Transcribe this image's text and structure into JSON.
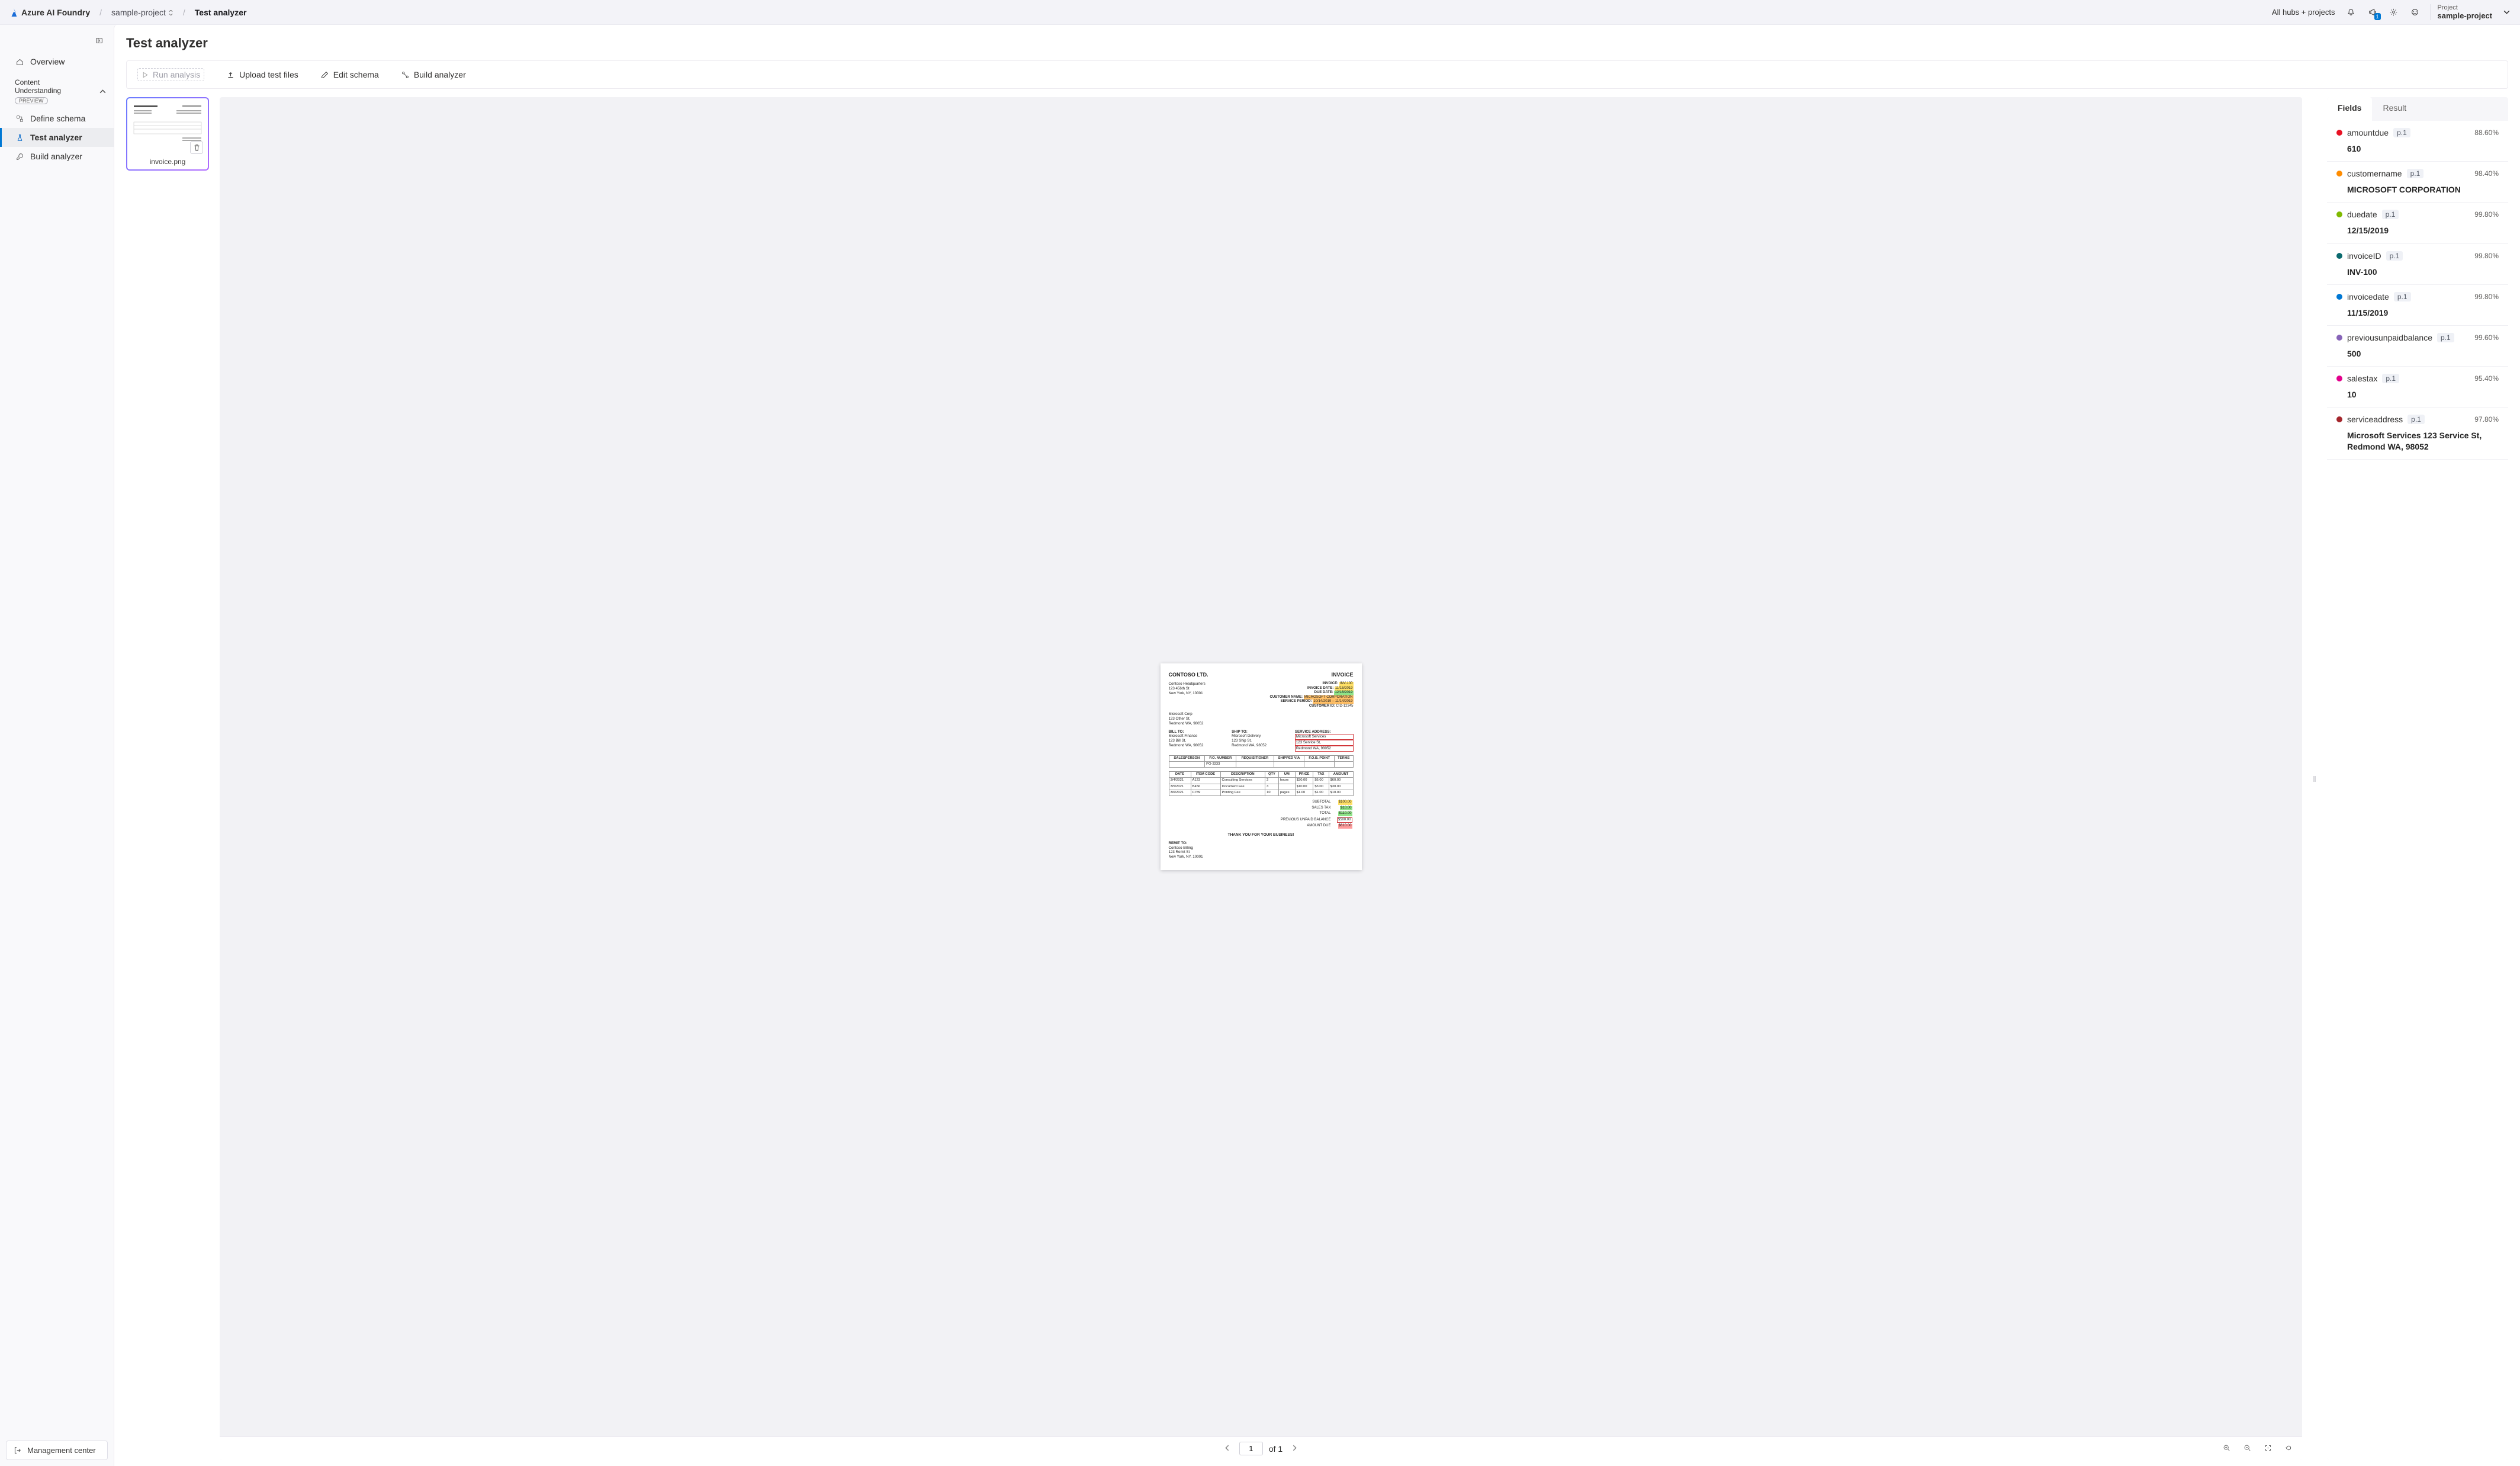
{
  "brand": "Azure AI Foundry",
  "breadcrumb": {
    "project": "sample-project",
    "page": "Test analyzer"
  },
  "topbar": {
    "hubs_label": "All hubs + projects",
    "announce_badge": "1",
    "project_label": "Project",
    "project_value": "sample-project"
  },
  "sidebar": {
    "overview": "Overview",
    "group_line1": "Content",
    "group_line2": "Understanding",
    "group_pill": "PREVIEW",
    "define_schema": "Define schema",
    "test_analyzer": "Test analyzer",
    "build_analyzer": "Build analyzer",
    "management_center": "Management center"
  },
  "page": {
    "title": "Test analyzer"
  },
  "toolbar": {
    "run": "Run analysis",
    "upload": "Upload test files",
    "edit_schema": "Edit schema",
    "build": "Build analyzer"
  },
  "thumbnail": {
    "caption": "invoice.png"
  },
  "viewer": {
    "page_input": "1",
    "page_total": "of 1"
  },
  "tabs": {
    "fields": "Fields",
    "result": "Result"
  },
  "fields": [
    {
      "color": "#e81123",
      "name": "amountdue",
      "page": "p.1",
      "conf": "88.60%",
      "value": "610"
    },
    {
      "color": "#ff8c00",
      "name": "customername",
      "page": "p.1",
      "conf": "98.40%",
      "value": "MICROSOFT CORPORATION"
    },
    {
      "color": "#7fba00",
      "name": "duedate",
      "page": "p.1",
      "conf": "99.80%",
      "value": "12/15/2019"
    },
    {
      "color": "#0b6a6e",
      "name": "invoiceID",
      "page": "p.1",
      "conf": "99.80%",
      "value": "INV-100"
    },
    {
      "color": "#0078d4",
      "name": "invoicedate",
      "page": "p.1",
      "conf": "99.80%",
      "value": "11/15/2019"
    },
    {
      "color": "#8764b8",
      "name": "previousunpaidbalance",
      "page": "p.1",
      "conf": "99.60%",
      "value": "500"
    },
    {
      "color": "#e3008c",
      "name": "salestax",
      "page": "p.1",
      "conf": "95.40%",
      "value": "10"
    },
    {
      "color": "#a4262c",
      "name": "serviceaddress",
      "page": "p.1",
      "conf": "97.80%",
      "value": "Microsoft Services 123 Service St, Redmond WA, 98052"
    }
  ],
  "invoice": {
    "company": "CONTOSO LTD.",
    "doc_type": "INVOICE",
    "hq": [
      "Contoso Headquarters",
      "123 456th St",
      "New York, NY, 10001"
    ],
    "meta": {
      "invoice_label": "INVOICE:",
      "invoice_val": "INV-100",
      "invoice_date_label": "INVOICE DATE:",
      "invoice_date_val": "11/15/2019",
      "due_date_label": "DUE DATE:",
      "due_date_val": "12/15/2019",
      "customer_name_label": "CUSTOMER NAME:",
      "customer_name_val": "MICROSOFT CORPORATION",
      "service_period_label": "SERVICE PERIOD:",
      "service_period_val": "10/14/2019 – 11/14/2019",
      "customer_id_label": "CUSTOMER ID:",
      "customer_id_val": "CID-12345"
    },
    "shipto_block": [
      "Microsoft Corp",
      "123 Other St,",
      "Redmond WA, 98052"
    ],
    "bill_to_h": "BILL TO:",
    "bill_to": [
      "Microsoft Finance",
      "123 Bill St,",
      "Redmond WA, 98052"
    ],
    "ship_to_h": "SHIP TO:",
    "ship_to": [
      "Microsoft Delivery",
      "123 Ship St,",
      "Redmond WA, 98052"
    ],
    "svc_addr_h": "SERVICE ADDRESS:",
    "svc_addr": [
      "Microsoft Services",
      "123 Service St,",
      "Redmond WA, 98052"
    ],
    "order_headers": [
      "SALESPERSON",
      "P.O. NUMBER",
      "REQUISITIONER",
      "SHIPPED VIA",
      "F.O.B. POINT",
      "TERMS"
    ],
    "order_row": [
      "",
      "PO-3333",
      "",
      "",
      "",
      ""
    ],
    "item_headers": [
      "DATE",
      "ITEM CODE",
      "DESCRIPTION",
      "QTY",
      "UM",
      "PRICE",
      "TAX",
      "AMOUNT"
    ],
    "items": [
      [
        "3/4/2021",
        "A123",
        "Consulting Services",
        "2",
        "hours",
        "$30.00",
        "$6.00",
        "$60.00"
      ],
      [
        "3/5/2021",
        "B456",
        "Document Fee",
        "3",
        "",
        "$10.00",
        "$3.00",
        "$30.00"
      ],
      [
        "3/6/2021",
        "C789",
        "Printing Fee",
        "10",
        "pages",
        "$1.00",
        "$1.00",
        "$10.00"
      ]
    ],
    "totals": [
      [
        "SUBTOTAL",
        "$100.00",
        "hl-yel"
      ],
      [
        "SALES TAX",
        "$10.00",
        "hl-grn"
      ],
      [
        "TOTAL",
        "$110.00",
        "hl-grn"
      ],
      [
        "PREVIOUS UNPAID BALANCE",
        "$500.00",
        "hl-redbox"
      ],
      [
        "AMOUNT DUE",
        "$610.00",
        "hl-red"
      ]
    ],
    "thank": "THANK YOU FOR YOUR BUSINESS!",
    "remit_h": "REMIT TO:",
    "remit": [
      "Contoso Billing",
      "123 Remit St",
      "New York, NY, 10001"
    ]
  }
}
